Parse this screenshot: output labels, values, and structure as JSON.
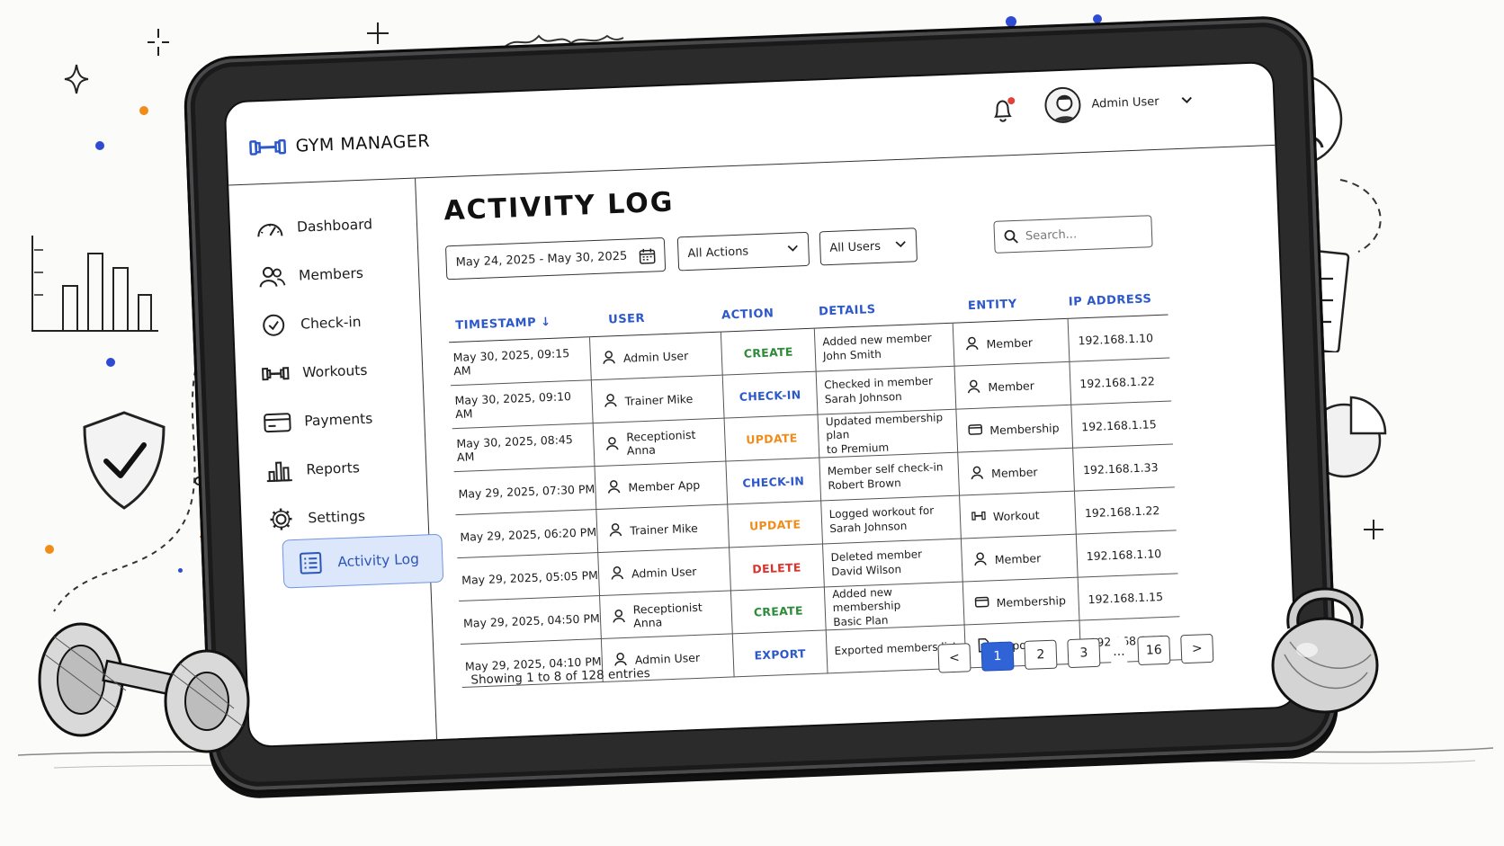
{
  "app": {
    "brand": "GYM MANAGER",
    "user_name": "Admin User",
    "notification_icon": "bell-icon",
    "accent": "#2f63d6"
  },
  "sidebar": {
    "items": [
      {
        "label": "Dashboard",
        "icon": "speedometer-icon"
      },
      {
        "label": "Members",
        "icon": "users-icon"
      },
      {
        "label": "Check-in",
        "icon": "clock-check-icon"
      },
      {
        "label": "Workouts",
        "icon": "dumbbell-icon"
      },
      {
        "label": "Payments",
        "icon": "credit-card-icon"
      },
      {
        "label": "Reports",
        "icon": "bar-chart-icon"
      },
      {
        "label": "Settings",
        "icon": "gear-icon"
      },
      {
        "label": "Activity Log",
        "icon": "list-icon",
        "active": true
      }
    ]
  },
  "main": {
    "title": "ACTIVITY LOG",
    "filters": {
      "date_range": "May 24, 2025 - May 30, 2025",
      "action": "All Actions",
      "user": "All Users",
      "search_placeholder": "Search..."
    },
    "columns": [
      "TIMESTAMP",
      "USER",
      "ACTION",
      "DETAILS",
      "ENTITY",
      "IP ADDRESS"
    ],
    "rows": [
      {
        "timestamp": "May 30, 2025, 09:15 AM",
        "user": "Admin User",
        "action": "CREATE",
        "details1": "Added new member",
        "details2": "John Smith",
        "entity": "Member",
        "entity_icon": "user-icon",
        "ip": "192.168.1.10"
      },
      {
        "timestamp": "May 30, 2025, 09:10 AM",
        "user": "Trainer Mike",
        "action": "CHECK-IN",
        "details1": "Checked in member",
        "details2": "Sarah Johnson",
        "entity": "Member",
        "entity_icon": "user-icon",
        "ip": "192.168.1.22"
      },
      {
        "timestamp": "May 30, 2025, 08:45 AM",
        "user": "Receptionist Anna",
        "action": "UPDATE",
        "details1": "Updated membership plan",
        "details2": "to Premium",
        "entity": "Membership",
        "entity_icon": "card-icon",
        "ip": "192.168.1.15"
      },
      {
        "timestamp": "May 29, 2025, 07:30 PM",
        "user": "Member App",
        "action": "CHECK-IN",
        "details1": "Member self check-in",
        "details2": "Robert Brown",
        "entity": "Member",
        "entity_icon": "user-icon",
        "ip": "192.168.1.33"
      },
      {
        "timestamp": "May 29, 2025, 06:20 PM",
        "user": "Trainer Mike",
        "action": "UPDATE",
        "details1": "Logged workout for",
        "details2": "Sarah Johnson",
        "entity": "Workout",
        "entity_icon": "dumbbell-icon",
        "ip": "192.168.1.22"
      },
      {
        "timestamp": "May 29, 2025, 05:05 PM",
        "user": "Admin User",
        "action": "DELETE",
        "details1": "Deleted member",
        "details2": "David Wilson",
        "entity": "Member",
        "entity_icon": "user-icon",
        "ip": "192.168.1.10"
      },
      {
        "timestamp": "May 29, 2025, 04:50 PM",
        "user": "Receptionist Anna",
        "action": "CREATE",
        "details1": "Added new membership",
        "details2": "Basic Plan",
        "entity": "Membership",
        "entity_icon": "card-icon",
        "ip": "192.168.1.15"
      },
      {
        "timestamp": "May 29, 2025, 04:10 PM",
        "user": "Admin User",
        "action": "EXPORT",
        "details1": "Exported members list",
        "details2": "",
        "entity": "Report",
        "entity_icon": "document-icon",
        "ip": "192.168.1.10"
      }
    ],
    "footer": "Showing 1 to 8 of 128 entries",
    "pagination": {
      "prev": "<",
      "pages": [
        "1",
        "2",
        "3"
      ],
      "ellipsis": "...",
      "last": "16",
      "next": ">",
      "current": "1"
    }
  },
  "action_colors": {
    "CREATE": "#2e8b3a",
    "CHECK-IN": "#2c58c9",
    "UPDATE": "#f08c1a",
    "DELETE": "#d8342e",
    "EXPORT": "#2c58c9"
  }
}
